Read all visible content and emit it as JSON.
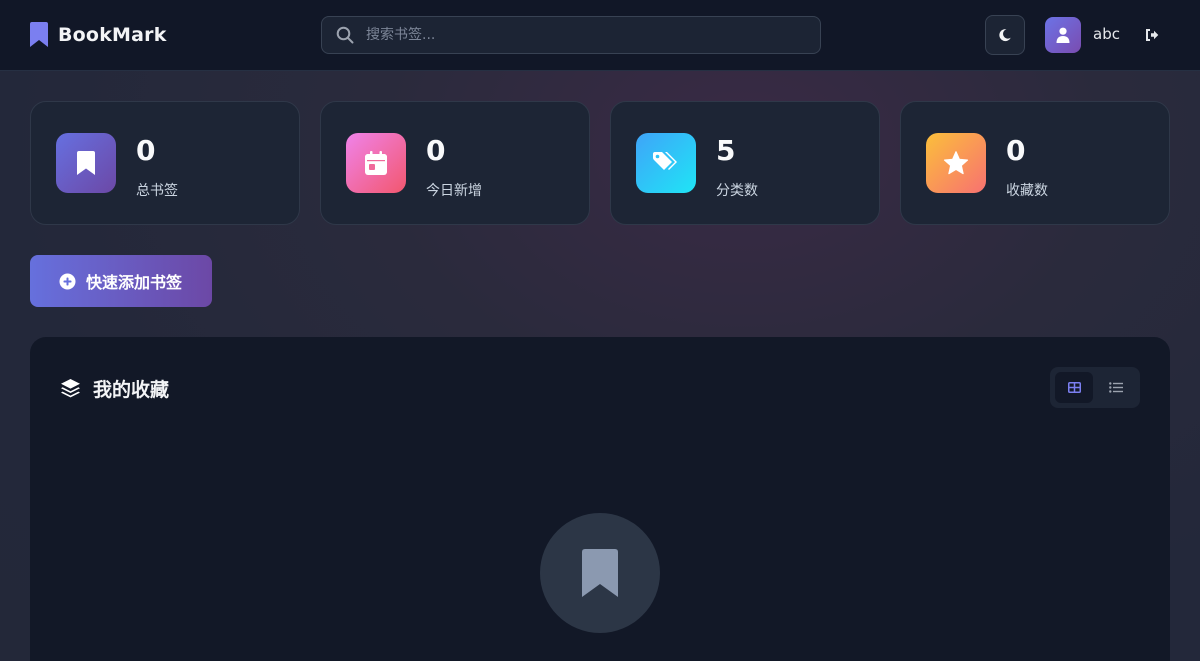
{
  "header": {
    "brand": "BookMark",
    "search_placeholder": "搜索书签...",
    "username": "abc"
  },
  "stats": [
    {
      "value": "0",
      "label": "总书签",
      "icon": "bookmark-icon"
    },
    {
      "value": "0",
      "label": "今日新增",
      "icon": "calendar-icon"
    },
    {
      "value": "5",
      "label": "分类数",
      "icon": "tags-icon"
    },
    {
      "value": "0",
      "label": "收藏数",
      "icon": "star-icon"
    }
  ],
  "quick_add": {
    "label": "快速添加书签"
  },
  "panel": {
    "title": "我的收藏",
    "view_mode": "grid"
  },
  "colors": {
    "accent": "#6c73e6",
    "background": "#121827"
  }
}
